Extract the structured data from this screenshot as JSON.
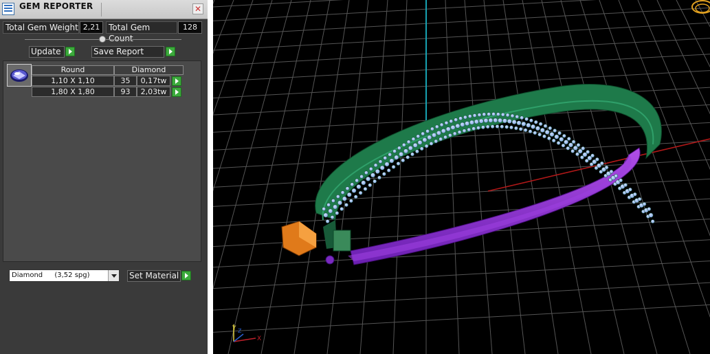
{
  "panel": {
    "title": "GEM REPORTER",
    "close_glyph": "✕",
    "total_weight_label": "Total Gem Weight",
    "total_weight_value": "2,21",
    "total_count_label": "Total Gem Count",
    "total_count_value": "128",
    "update_label": "Update",
    "save_report_label": "Save Report",
    "table": {
      "headers": [
        "Round",
        "Diamond"
      ],
      "rows": [
        {
          "size": "1,10 X 1,10",
          "count": "35",
          "weight": "0,17tw"
        },
        {
          "size": "1,80 X 1,80",
          "count": "93",
          "weight": "2,03tw"
        }
      ]
    },
    "material": {
      "selected": "Diamond",
      "selected_density": "(3,52 spg)"
    },
    "set_material_label": "Set Material"
  },
  "viewport": {
    "axis_labels": {
      "x": "X",
      "y": "Y",
      "z": "Z"
    },
    "colors": {
      "background": "#000000",
      "grid": "#555555",
      "axis_y": "#17a3b3",
      "axis_x": "#b01818",
      "shank_green": "#1e7a4a",
      "inner_purple": "#8a2be2",
      "gem_blue": "#9fbde6",
      "clasp_orange": "#e07a1a"
    }
  }
}
